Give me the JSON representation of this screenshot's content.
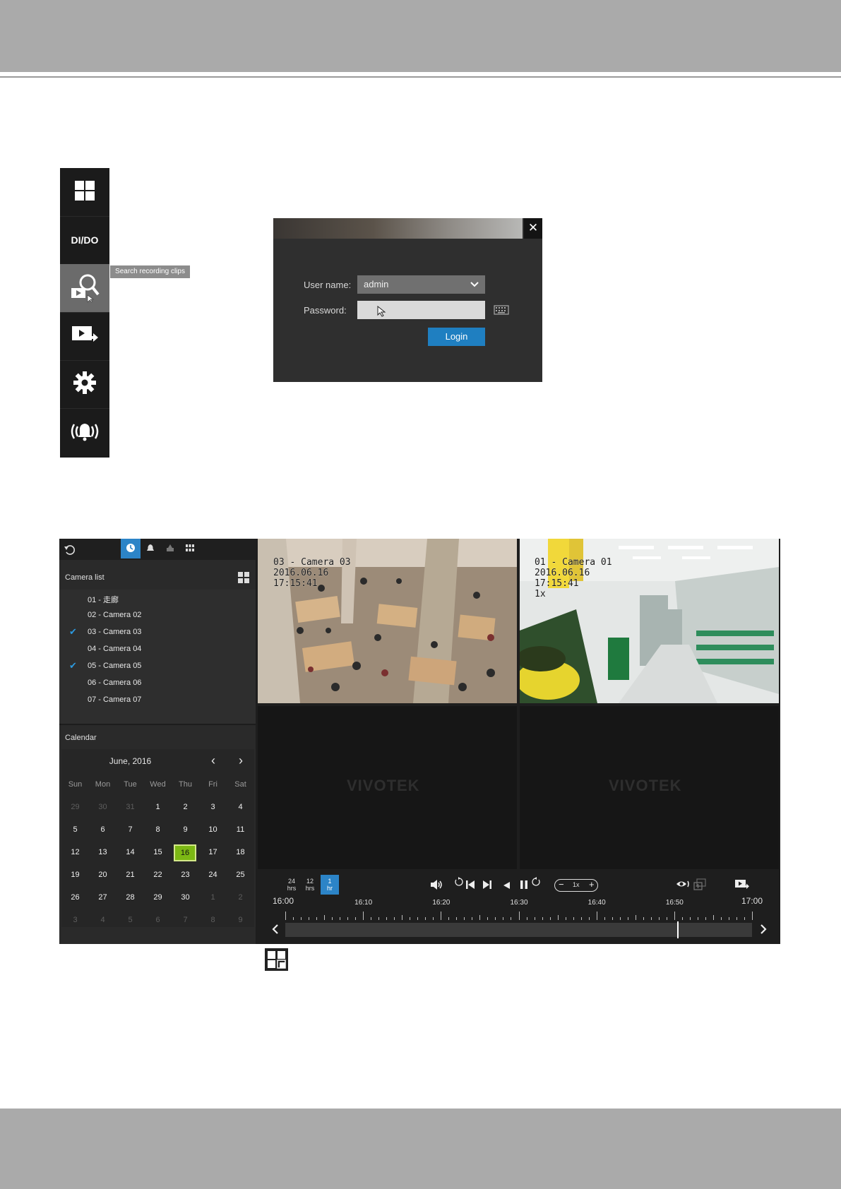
{
  "tooltip": "Search recording clips",
  "toolbar": {
    "dido_label": "DI/DO"
  },
  "login": {
    "close": "✕",
    "username_label": "User name:",
    "username_value": "admin",
    "password_label": "Password:",
    "password_value": "",
    "login_button": "Login"
  },
  "camera_panel": {
    "title": "Camera list",
    "cameras": [
      {
        "label": "01 - 走廊",
        "checked": false
      },
      {
        "label": "02 - Camera 02",
        "checked": false
      },
      {
        "label": "03 - Camera 03",
        "checked": true
      },
      {
        "label": "04 - Camera 04",
        "checked": false
      },
      {
        "label": "05 - Camera 05",
        "checked": true
      },
      {
        "label": "06 - Camera 06",
        "checked": false
      },
      {
        "label": "07 - Camera 07",
        "checked": false
      }
    ]
  },
  "calendar": {
    "title": "Calendar",
    "month": "June, 2016",
    "prev": "‹",
    "next": "›",
    "weekdays": [
      "Sun",
      "Mon",
      "Tue",
      "Wed",
      "Thu",
      "Fri",
      "Sat"
    ],
    "weeks": [
      [
        "29",
        "30",
        "31",
        "1",
        "2",
        "3",
        "4"
      ],
      [
        "5",
        "6",
        "7",
        "8",
        "9",
        "10",
        "11"
      ],
      [
        "12",
        "13",
        "14",
        "15",
        "16",
        "17",
        "18"
      ],
      [
        "19",
        "20",
        "21",
        "22",
        "23",
        "24",
        "25"
      ],
      [
        "26",
        "27",
        "28",
        "29",
        "30",
        "1",
        "2"
      ],
      [
        "3",
        "4",
        "5",
        "6",
        "7",
        "8",
        "9"
      ]
    ],
    "selected": "16"
  },
  "videos": {
    "tile1": {
      "line1": "03 - Camera 03",
      "line2": "2016.06.16",
      "line3": "17:15:41"
    },
    "tile2": {
      "line1": "01 - Camera 01",
      "line2": "2016.06.16",
      "line3": "17:15:41",
      "line4": "1x"
    },
    "brand": "VIVOTEK"
  },
  "playback": {
    "ranges": [
      {
        "top": "24",
        "bottom": "hrs"
      },
      {
        "top": "12",
        "bottom": "hrs"
      },
      {
        "top": "1",
        "bottom": "hr"
      }
    ],
    "speed": "1x",
    "start_time": "16:00",
    "end_time": "17:00",
    "ticks": [
      "16:10",
      "16:20",
      "16:30",
      "16:40",
      "16:50"
    ],
    "playhead_fraction": 0.84
  },
  "colors": {
    "accent": "#2c84c7",
    "today": "#7cb814"
  }
}
